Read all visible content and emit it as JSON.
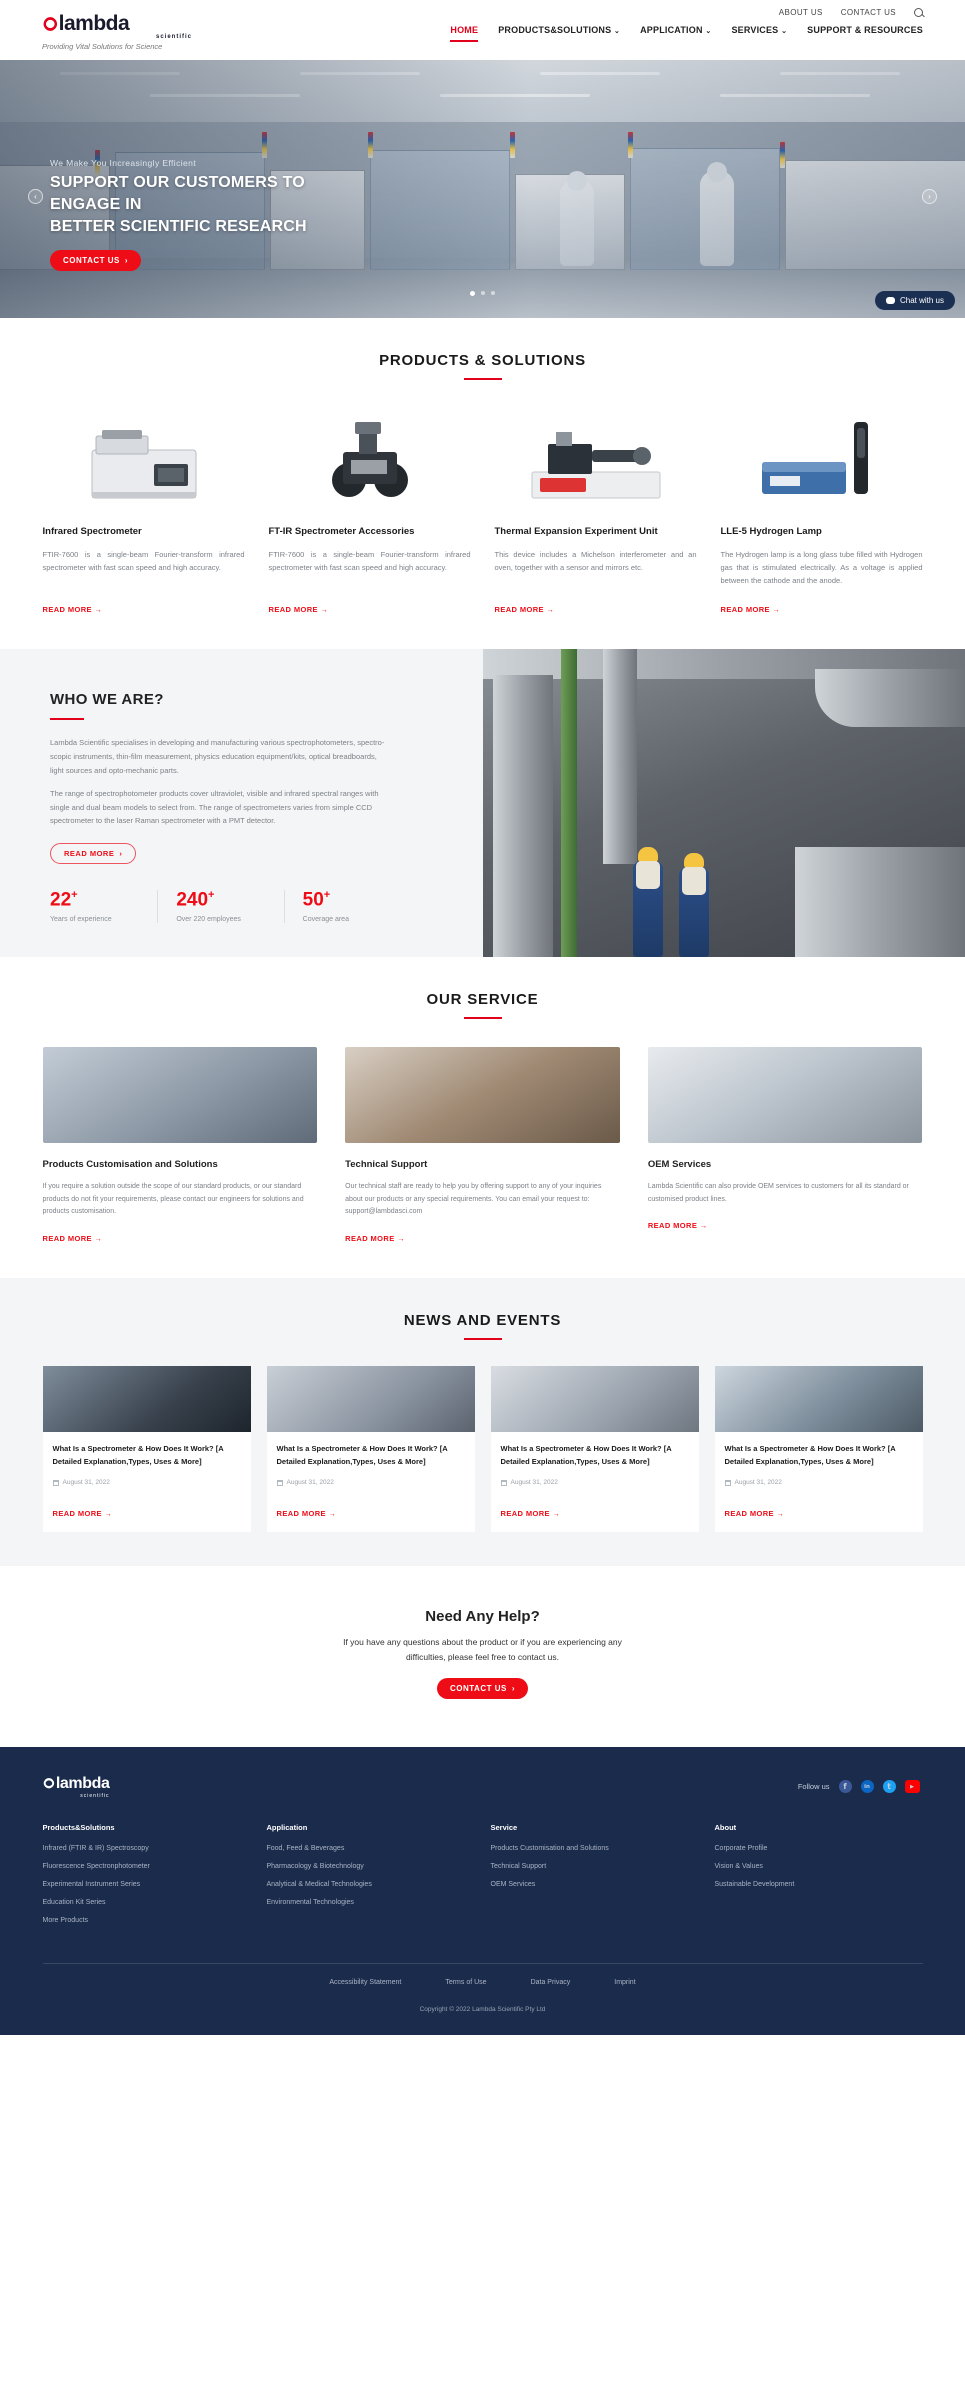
{
  "header": {
    "topbar": [
      {
        "label": "ABOUT US"
      },
      {
        "label": "CONTACT US"
      }
    ],
    "search_icon": "search-icon",
    "logo": {
      "mark": "ഠ",
      "word": "lambda",
      "sub": "scientific",
      "tagline": "Providing Vital Solutions for Science"
    },
    "nav": [
      {
        "label": "HOME",
        "active": true,
        "caret": ""
      },
      {
        "label": "PRODUCTS&SOLUTIONS",
        "active": false,
        "caret": "⌄"
      },
      {
        "label": "APPLICATION",
        "active": false,
        "caret": "⌄"
      },
      {
        "label": "SERVICES",
        "active": false,
        "caret": "⌄"
      },
      {
        "label": "SUPPORT & RESOURCES",
        "active": false,
        "caret": ""
      }
    ]
  },
  "hero": {
    "kicker": "We Make You Increasingly Efficient",
    "title_line1": "SUPPORT OUR CUSTOMERS TO ENGAGE IN",
    "title_line2": "BETTER SCIENTIFIC RESEARCH",
    "cta": "CONTACT US",
    "cta_arrow": "›",
    "prev_arrow": "‹",
    "next_arrow": "›",
    "dots": 3,
    "active_dot": 0,
    "chat_label": "Chat with us"
  },
  "products": {
    "title": "PRODUCTS & SOLUTIONS",
    "read_more": "READ MORE",
    "arrow": "→",
    "items": [
      {
        "name": "Infrared Spectrometer",
        "desc": "FTIR-7600 is a single-beam Fourier-transform infrared spectrometer with fast scan speed and high accuracy."
      },
      {
        "name": "FT-IR Spectrometer Accessories",
        "desc": "FTIR-7600 is a single-beam Fourier-transform infrared spectrometer with fast scan speed and high accuracy."
      },
      {
        "name": "Thermal Expansion Experiment Unit",
        "desc": "This device includes a Michelson interferometer and an oven, together with a sensor and mirrors etc."
      },
      {
        "name": "LLE-5 Hydrogen Lamp",
        "desc": "The Hydrogen lamp is a long glass tube filled with Hydrogen gas that is stimulated electrically. As a voltage is applied between the cathode and the anode."
      }
    ]
  },
  "who": {
    "title": "WHO WE ARE?",
    "paragraph1": "Lambda Scientific specialises in developing and manufacturing various spectrophotometers, spectro-scopic instruments, thin-film measurement, physics education equipment/kits, optical breadboards, light sources and opto-mechanic parts.",
    "paragraph2": "The range of spectrophotometer products cover ultraviolet, visible and infrared spectral ranges with single and dual beam models to select from. The range of spectrometers varies from simple CCD spectrometer to the laser Raman spectrometer with a PMT detector.",
    "cta": "READ MORE",
    "cta_arrow": "›",
    "stats": [
      {
        "number": "22",
        "plus": "+",
        "label": "Years of experience"
      },
      {
        "number": "240",
        "plus": "+",
        "label": "Over 220 employees"
      },
      {
        "number": "50",
        "plus": "+",
        "label": "Coverage area"
      }
    ]
  },
  "service": {
    "title": "OUR SERVICE",
    "read_more": "READ MORE",
    "arrow": "→",
    "items": [
      {
        "name": "Products Customisation and Solutions",
        "desc": "If you require a solution outside the scope of our standard products, or our standard products do not fit your requirements, please contact our engineers for solutions and products customisation."
      },
      {
        "name": "Technical Support",
        "desc": "Our technical staff are ready to help you by offering support to any of your inquiries about our products or any special requirements. You can email your request to: support@lambdasci.com"
      },
      {
        "name": "OEM Services",
        "desc": "Lambda Scientific can also provide OEM services to customers for all its standard or customised product lines."
      }
    ]
  },
  "news": {
    "title": "NEWS AND EVENTS",
    "read_more": "READ MORE",
    "arrow": "→",
    "items": [
      {
        "title": "What Is a Spectrometer & How Does It Work? [A Detailed Explanation,Types, Uses & More]",
        "date": "August 31, 2022"
      },
      {
        "title": "What Is a Spectrometer & How Does It Work? [A Detailed Explanation,Types, Uses & More]",
        "date": "August 31, 2022"
      },
      {
        "title": "What Is a Spectrometer & How Does It Work? [A Detailed Explanation,Types, Uses & More]",
        "date": "August 31, 2022"
      },
      {
        "title": "What Is a Spectrometer & How Does It Work? [A Detailed Explanation,Types, Uses & More]",
        "date": "August 31, 2022"
      }
    ]
  },
  "help": {
    "title": "Need Any Help?",
    "text": "If you have any questions about the product or if you are experiencing any difficulties, please feel free to contact us.",
    "cta": "CONTACT US",
    "cta_arrow": "›"
  },
  "footer": {
    "logo": {
      "mark": "ഠ",
      "word": "lambda",
      "sub": "scientific"
    },
    "follow_label": "Follow us",
    "social": [
      {
        "name": "facebook-icon",
        "glyph": "f",
        "color": "#3b5998"
      },
      {
        "name": "linkedin-icon",
        "glyph": "in",
        "color": "#0a66c2"
      },
      {
        "name": "twitter-icon",
        "glyph": "t",
        "color": "#1da1f2"
      },
      {
        "name": "youtube-icon",
        "glyph": "▶",
        "color": "#ff0000"
      }
    ],
    "columns": [
      {
        "heading": "Products&Solutions",
        "links": [
          "Infrared (FTIR & IR) Spectroscopy",
          "Fluorescence Spectronphotometer",
          "Experimental Instrument Series",
          "Education Kit Series",
          "More Products"
        ]
      },
      {
        "heading": "Application",
        "links": [
          "Food, Feed & Beverages",
          "Pharmacology & Biotechnology",
          "Analytical & Medical Technologies",
          "Environmental Technologies"
        ]
      },
      {
        "heading": "Service",
        "links": [
          "Products Customisation and Solutions",
          "Technical Support",
          "OEM Services"
        ]
      },
      {
        "heading": "About",
        "links": [
          "Corporate Profile",
          "Vision & Values",
          "Sustainable Development"
        ]
      }
    ],
    "legal": [
      "Accessibility Statement",
      "Terms of Use",
      "Data Privacy",
      "Imprint"
    ],
    "copyright": "Copyright © 2022 Lambda Scientific Pty Ltd"
  },
  "colors": {
    "accent_red": "#ee0d16",
    "footer_navy": "#1b2b4b",
    "section_gray": "#f4f5f6"
  }
}
